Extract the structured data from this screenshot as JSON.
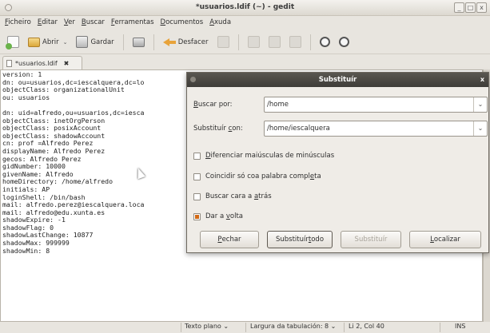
{
  "window": {
    "title": "*usuarios.ldif (~) - gedit",
    "buttons": [
      "_",
      "□",
      "x"
    ]
  },
  "menubar": {
    "items": [
      {
        "key": "F",
        "rest": "icheiro"
      },
      {
        "key": "E",
        "rest": "ditar"
      },
      {
        "key": "V",
        "rest": "er"
      },
      {
        "key": "B",
        "rest": "uscar"
      },
      {
        "key": "F",
        "rest": "erramentas"
      },
      {
        "key": "D",
        "rest": "ocumentos"
      },
      {
        "key": "A",
        "rest": "xuda"
      }
    ]
  },
  "toolbar": {
    "open_label": "Abrir",
    "save_label": "Gardar",
    "undo_label": "Desfacer"
  },
  "tab": {
    "label": "*usuarios.ldif",
    "close": "✖"
  },
  "editor": {
    "lines": [
      "version: 1",
      "dn: ou=usuarios,dc=iescalquera,dc=lo",
      "objectClass: organizationalUnit",
      "ou: usuarios",
      "",
      "dn: uid=alfredo,ou=usuarios,dc=iesca",
      "objectClass: inetOrgPerson",
      "objectClass: posixAccount",
      "objectClass: shadowAccount",
      "cn: prof =Alfredo Perez",
      "displayName: Alfredo Perez",
      "gecos: Alfredo Perez",
      "gidNumber: 10000",
      "givenName: Alfredo",
      "homeDirectory: /home/alfredo",
      "initials: AP",
      "loginShell: /bin/bash",
      "mail: alfredo.perez@iescalquera.loca",
      "mail: alfredo@edu.xunta.es",
      "shadowExpire: -1",
      "shadowFlag: 0",
      "shadowLastChange: 10877",
      "shadowMax: 999999",
      "shadowMin: 8"
    ]
  },
  "statusbar": {
    "language": "Texto plano ⌄",
    "tab_width": "Largura da tabulación: 8 ⌄",
    "position": "Li 2, Col 40",
    "mode": "INS"
  },
  "dialog": {
    "title": "Substituír",
    "close": "x",
    "search_label": {
      "key": "B",
      "rest": "uscar por:"
    },
    "search_value": "/home",
    "replace_label": {
      "pre": "Substituír ",
      "key": "c",
      "rest": "on:"
    },
    "replace_value": "/home/iescalquera",
    "options": [
      {
        "pre": "",
        "key": "D",
        "rest": "iferenciar maiúsculas de minúsculas",
        "checked": false
      },
      {
        "pre": "Coincidir só coa palabra compl",
        "key": "e",
        "rest": "ta",
        "checked": false
      },
      {
        "pre": "Buscar cara a ",
        "key": "a",
        "rest": "trás",
        "checked": false
      },
      {
        "pre": "Dar a ",
        "key": "v",
        "rest": "olta",
        "checked": true
      }
    ],
    "buttons": {
      "close": {
        "pre": "",
        "key": "P",
        "rest": "echar"
      },
      "replace_all": {
        "pre": "Substituír ",
        "key": "t",
        "rest": "odo"
      },
      "replace": "Substituír",
      "find": {
        "pre": "",
        "key": "L",
        "rest": "ocalizar"
      }
    }
  }
}
